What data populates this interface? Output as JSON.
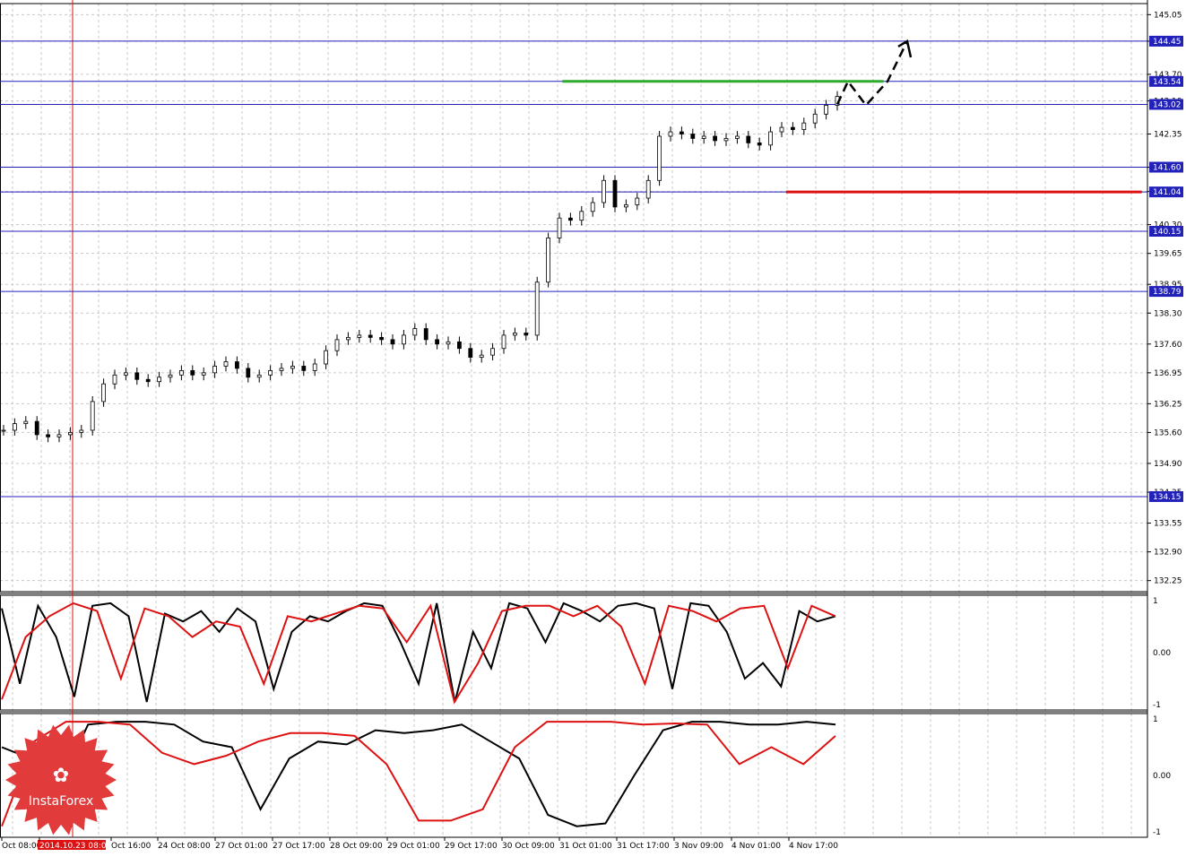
{
  "chart_data": [
    {
      "type": "candlestick",
      "title": "",
      "price_axis": {
        "ylim": [
          132.0,
          145.3
        ],
        "ticks": [
          "145.05",
          "144.45",
          "143.70",
          "143.10",
          "142.35",
          "141.60",
          "141.05",
          "140.30",
          "139.65",
          "138.95",
          "138.30",
          "137.60",
          "136.95",
          "136.25",
          "135.60",
          "134.90",
          "134.25",
          "133.55",
          "132.90",
          "132.25"
        ]
      },
      "time_axis": {
        "labels": [
          "Oct 08:00",
          "2014.10.23 08:00",
          "Oct 16:00",
          "24 Oct 08:00",
          "27 Oct 01:00",
          "27 Oct 17:00",
          "28 Oct 09:00",
          "29 Oct 01:00",
          "29 Oct 17:00",
          "30 Oct 09:00",
          "31 Oct 01:00",
          "31 Oct 17:00",
          "3 Nov 09:00",
          "4 Nov 01:00",
          "4 Nov 17:00"
        ],
        "highlighted_label": "2014.10.23 08:00"
      },
      "horizontal_levels": [
        {
          "label": "144.45",
          "price": 144.45,
          "color": "#2222bb"
        },
        {
          "label": "143.54",
          "price": 143.54,
          "color": "#2222bb"
        },
        {
          "label": "143.02",
          "price": 143.02,
          "color": "#2222bb"
        },
        {
          "label": "141.60",
          "price": 141.6,
          "color": "#2222bb"
        },
        {
          "label": "141.04",
          "price": 141.04,
          "color": "#2222bb"
        },
        {
          "label": "140.15",
          "price": 140.15,
          "color": "#2222bb"
        },
        {
          "label": "138.79",
          "price": 138.79,
          "color": "#2222bb"
        },
        {
          "label": "134.15",
          "price": 134.15,
          "color": "#2222bb"
        }
      ],
      "trend_segments": [
        {
          "name": "resistance",
          "price": 143.54,
          "color": "#2eaa2e",
          "start_fraction": 0.49,
          "end_fraction": 0.77
        },
        {
          "name": "support",
          "price": 141.04,
          "color": "#dd1111",
          "start_fraction": 0.685,
          "end_fraction": 0.995
        }
      ],
      "close_path": [
        135.65,
        135.8,
        135.85,
        135.55,
        135.5,
        135.55,
        135.6,
        135.65,
        136.3,
        136.7,
        136.9,
        136.95,
        136.8,
        136.75,
        136.85,
        136.9,
        137.0,
        136.9,
        136.95,
        137.1,
        137.2,
        137.05,
        136.85,
        136.9,
        137.0,
        137.05,
        137.1,
        137.0,
        137.15,
        137.45,
        137.7,
        137.75,
        137.8,
        137.75,
        137.7,
        137.6,
        137.8,
        137.95,
        137.7,
        137.6,
        137.65,
        137.5,
        137.3,
        137.35,
        137.5,
        137.8,
        137.85,
        137.8,
        139.0,
        140.0,
        140.45,
        140.4,
        140.6,
        140.8,
        141.3,
        140.7,
        140.75,
        140.9,
        141.3,
        142.3,
        142.4,
        142.35,
        142.25,
        142.3,
        142.2,
        142.25,
        142.3,
        142.15,
        142.1,
        142.4,
        142.5,
        142.45,
        142.6,
        142.8,
        143.0,
        143.2
      ],
      "arrow_projection": [
        143.02,
        143.54,
        143.0,
        143.54,
        144.45
      ]
    },
    {
      "type": "line",
      "name": "oscillator-1",
      "ylim": [
        -1,
        1
      ],
      "ticks": [
        "1",
        "0.00",
        "-1"
      ],
      "series": [
        {
          "color": "#000000",
          "values": [
            0.85,
            -0.6,
            0.9,
            0.3,
            -0.85,
            0.9,
            0.95,
            0.7,
            -0.95,
            0.75,
            0.6,
            0.8,
            0.4,
            0.85,
            0.6,
            -0.7,
            0.4,
            0.7,
            0.6,
            0.8,
            0.95,
            0.9,
            0.2,
            -0.6,
            0.95,
            -0.95,
            0.4,
            -0.3,
            0.95,
            0.85,
            0.2,
            0.95,
            0.8,
            0.6,
            0.9,
            0.95,
            0.85,
            -0.7,
            0.95,
            0.9,
            0.4,
            -0.5,
            -0.2,
            -0.65,
            0.8,
            0.6,
            0.7
          ]
        },
        {
          "color": "#dd1111",
          "values": [
            -0.9,
            0.3,
            0.7,
            0.95,
            0.8,
            -0.5,
            0.85,
            0.7,
            0.3,
            0.6,
            0.5,
            -0.6,
            0.7,
            0.6,
            0.75,
            0.9,
            0.85,
            0.2,
            0.9,
            -0.95,
            -0.2,
            0.8,
            0.9,
            0.9,
            0.7,
            0.9,
            0.5,
            -0.6,
            0.9,
            0.8,
            0.6,
            0.85,
            0.9,
            -0.3,
            0.9,
            0.7
          ]
        }
      ]
    },
    {
      "type": "line",
      "name": "oscillator-2",
      "ylim": [
        -1,
        1
      ],
      "ticks": [
        "1",
        "0.00",
        "-1"
      ],
      "series": [
        {
          "color": "#000000",
          "values": [
            0.5,
            0.3,
            -0.2,
            0.9,
            0.95,
            0.95,
            0.9,
            0.6,
            0.5,
            -0.6,
            0.3,
            0.6,
            0.55,
            0.8,
            0.75,
            0.8,
            0.9,
            0.6,
            0.3,
            -0.7,
            -0.9,
            -0.85,
            0.0,
            0.8,
            0.95,
            0.95,
            0.9,
            0.9,
            0.95,
            0.9
          ]
        },
        {
          "color": "#dd1111",
          "values": [
            -0.9,
            0.6,
            0.95,
            0.95,
            0.9,
            0.4,
            0.2,
            0.35,
            0.6,
            0.75,
            0.75,
            0.7,
            0.2,
            -0.8,
            -0.8,
            -0.6,
            0.5,
            0.95,
            0.95,
            0.95,
            0.9,
            0.92,
            0.9,
            0.2,
            0.5,
            0.2,
            0.7
          ]
        }
      ]
    }
  ],
  "logo": {
    "text": "InstaForex",
    "color": "#e23b3b"
  }
}
